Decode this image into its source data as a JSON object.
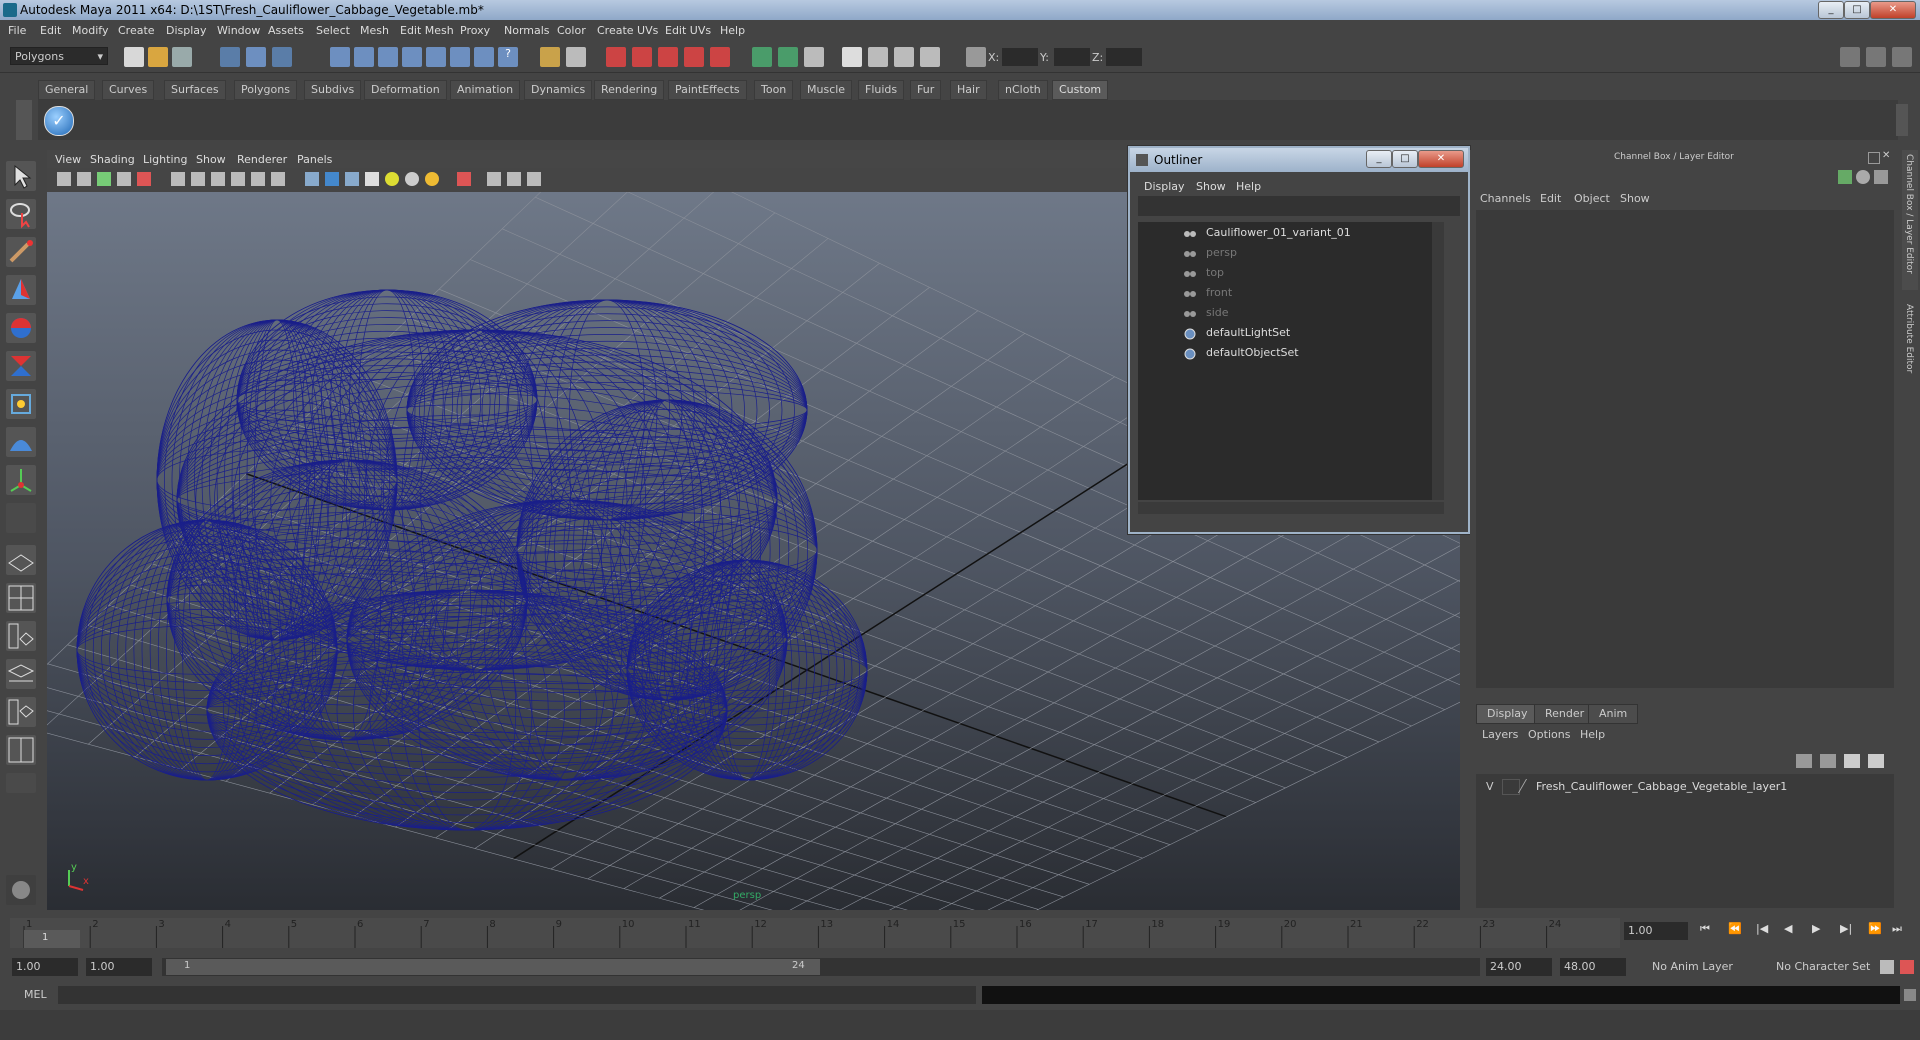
{
  "window": {
    "title": "Autodesk Maya 2011 x64: D:\\1ST\\Fresh_Cauliflower_Cabbage_Vegetable.mb*"
  },
  "menubar": [
    "File",
    "Edit",
    "Modify",
    "Create",
    "Display",
    "Window",
    "Assets",
    "Select",
    "Mesh",
    "Edit Mesh",
    "Proxy",
    "Normals",
    "Color",
    "Create UVs",
    "Edit UVs",
    "Help"
  ],
  "statusline": {
    "mode_select": "Polygons",
    "x_label": "X:",
    "y_label": "Y:",
    "z_label": "Z:"
  },
  "shelf_tabs": [
    "General",
    "Curves",
    "Surfaces",
    "Polygons",
    "Subdivs",
    "Deformation",
    "Animation",
    "Dynamics",
    "Rendering",
    "PaintEffects",
    "Toon",
    "Muscle",
    "Fluids",
    "Fur",
    "Hair",
    "nCloth",
    "Custom"
  ],
  "shelf_active": "Custom",
  "viewport": {
    "menu": [
      "View",
      "Shading",
      "Lighting",
      "Show",
      "Renderer",
      "Panels"
    ],
    "camera_label": "persp",
    "axis_x": "x",
    "axis_y": "y"
  },
  "outliner": {
    "title": "Outliner",
    "menu": [
      "Display",
      "Show",
      "Help"
    ],
    "items": [
      {
        "label": "Cauliflower_01_variant_01",
        "dim": false
      },
      {
        "label": "persp",
        "dim": true
      },
      {
        "label": "top",
        "dim": true
      },
      {
        "label": "front",
        "dim": true
      },
      {
        "label": "side",
        "dim": true
      },
      {
        "label": "defaultLightSet",
        "dim": false
      },
      {
        "label": "defaultObjectSet",
        "dim": false
      }
    ]
  },
  "channelbox": {
    "header": "Channel Box / Layer Editor",
    "menu": [
      "Channels",
      "Edit",
      "Object",
      "Show"
    ],
    "side_tab_1": "Channel Box / Layer Editor",
    "side_tab_2": "Attribute Editor",
    "layer_tabs": [
      "Display",
      "Render",
      "Anim"
    ],
    "layer_menu": [
      "Layers",
      "Options",
      "Help"
    ],
    "layer_visibility": "V",
    "layer_name": "Fresh_Cauliflower_Cabbage_Vegetable_layer1"
  },
  "timeline": {
    "ticks": [
      "1",
      "2",
      "3",
      "4",
      "5",
      "6",
      "7",
      "8",
      "9",
      "10",
      "11",
      "12",
      "13",
      "14",
      "15",
      "16",
      "17",
      "18",
      "19",
      "20",
      "21",
      "22",
      "23",
      "24"
    ],
    "current_frame_marker": "1",
    "current_time": "1.00"
  },
  "range": {
    "start_time": "1.00",
    "playback_start": "1.00",
    "range_start_label": "1",
    "range_end_label": "24",
    "playback_end": "24.00",
    "end_time": "48.00",
    "anim_layer": "No Anim Layer",
    "character_set": "No Character Set"
  },
  "cmdline": {
    "label": "MEL"
  }
}
